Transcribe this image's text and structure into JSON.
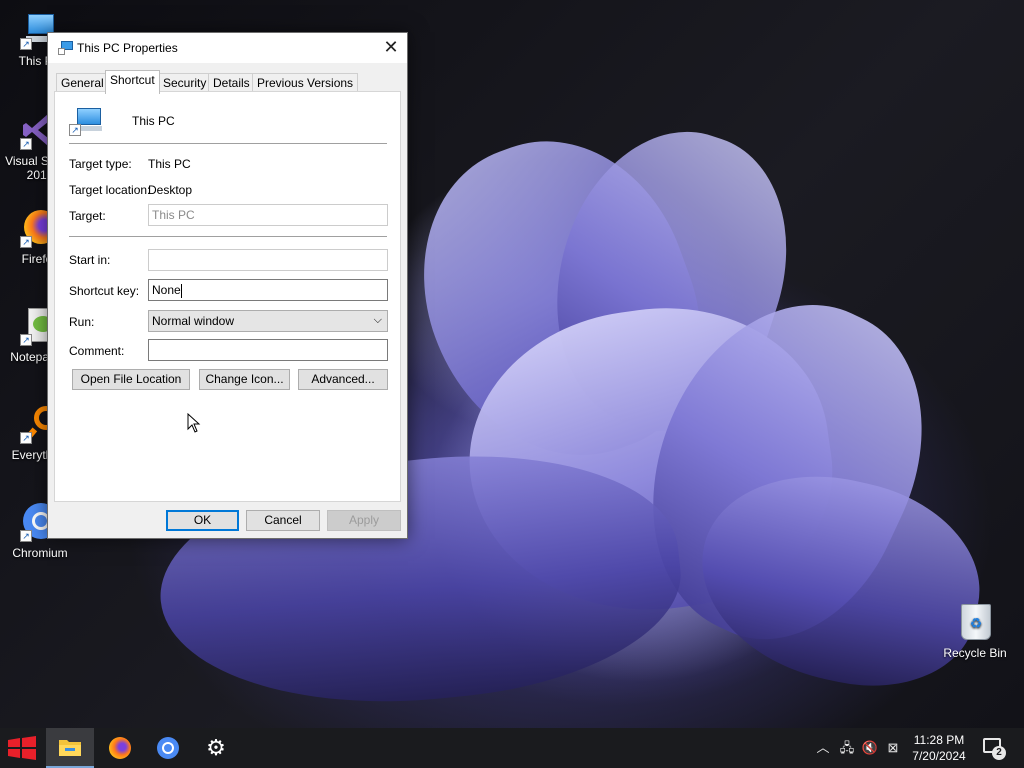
{
  "desktop": {
    "icons": [
      {
        "label": "This PC"
      },
      {
        "label": "Visual Studio 2017"
      },
      {
        "label": "Firefox"
      },
      {
        "label": "Notepad++"
      },
      {
        "label": "Everything"
      },
      {
        "label": "Chromium"
      },
      {
        "label": "Recycle Bin"
      }
    ]
  },
  "dialog": {
    "title": "This PC Properties",
    "close_label": "✕",
    "tabs": [
      {
        "label": "General",
        "active": false
      },
      {
        "label": "Shortcut",
        "active": true
      },
      {
        "label": "Security",
        "active": false
      },
      {
        "label": "Details",
        "active": false
      },
      {
        "label": "Previous Versions",
        "active": false
      }
    ],
    "shortcut_name": "This PC",
    "target_type_label": "Target type:",
    "target_type_value": "This PC",
    "target_location_label": "Target location:",
    "target_location_value": "Desktop",
    "target_label": "Target:",
    "target_value": "This PC",
    "start_in_label": "Start in:",
    "start_in_value": "",
    "shortcut_key_label": "Shortcut key:",
    "shortcut_key_value": "None",
    "run_label": "Run:",
    "run_value": "Normal window",
    "comment_label": "Comment:",
    "comment_value": "",
    "open_file_location_label": "Open File Location",
    "change_icon_label": "Change Icon...",
    "advanced_label": "Advanced...",
    "ok_label": "OK",
    "cancel_label": "Cancel",
    "apply_label": "Apply"
  },
  "taskbar": {
    "time": "11:28 PM",
    "date": "7/20/2024",
    "notification_count": "2",
    "pinned": [
      "start-icon",
      "file-explorer-icon",
      "firefox-icon",
      "chromium-icon",
      "settings-icon"
    ]
  },
  "colors": {
    "accent": "#0078d7",
    "taskbar_bg": "#1a1b1e",
    "dialog_bg": "#f0f0f0"
  }
}
